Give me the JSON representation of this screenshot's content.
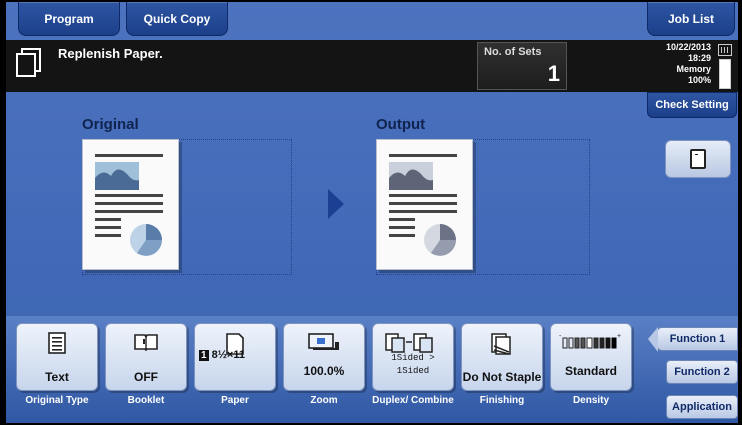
{
  "tabs": {
    "program": "Program",
    "quick_copy": "Quick Copy",
    "job_list": "Job List"
  },
  "status": {
    "message": "Replenish Paper.",
    "sets_label": "No. of Sets",
    "sets_value": "1",
    "date": "10/22/2013",
    "time": "18:29",
    "memory_label": "Memory",
    "memory_value": "100%",
    "check_setting": "Check Setting"
  },
  "preview": {
    "original_title": "Original",
    "output_title": "Output"
  },
  "functions": [
    {
      "value": "Text",
      "label": "Original Type",
      "icon": "document-lines-icon"
    },
    {
      "value": "OFF",
      "label": "Booklet",
      "icon": "open-book-icon"
    },
    {
      "value": "8½×11",
      "tray": "1",
      "label": "Paper",
      "icon": "paper-sheet-icon"
    },
    {
      "value": "100.0%",
      "label": "Zoom",
      "icon": "zoom-scan-icon"
    },
    {
      "value": "1Sided > 1Sided",
      "label": "Duplex/ Combine",
      "icon": "duplex-icon"
    },
    {
      "value": "Do Not Staple",
      "label": "Finishing",
      "icon": "staple-icon"
    },
    {
      "value": "Standard",
      "label": "Density",
      "icon": "density-scale-icon"
    }
  ],
  "side_tabs": {
    "function1": "Function 1",
    "function2": "Function 2",
    "application": "Application"
  },
  "colors": {
    "screen_bg": "#4169b7",
    "tab_bg": "#1c3f89",
    "status_bg": "#141414"
  }
}
